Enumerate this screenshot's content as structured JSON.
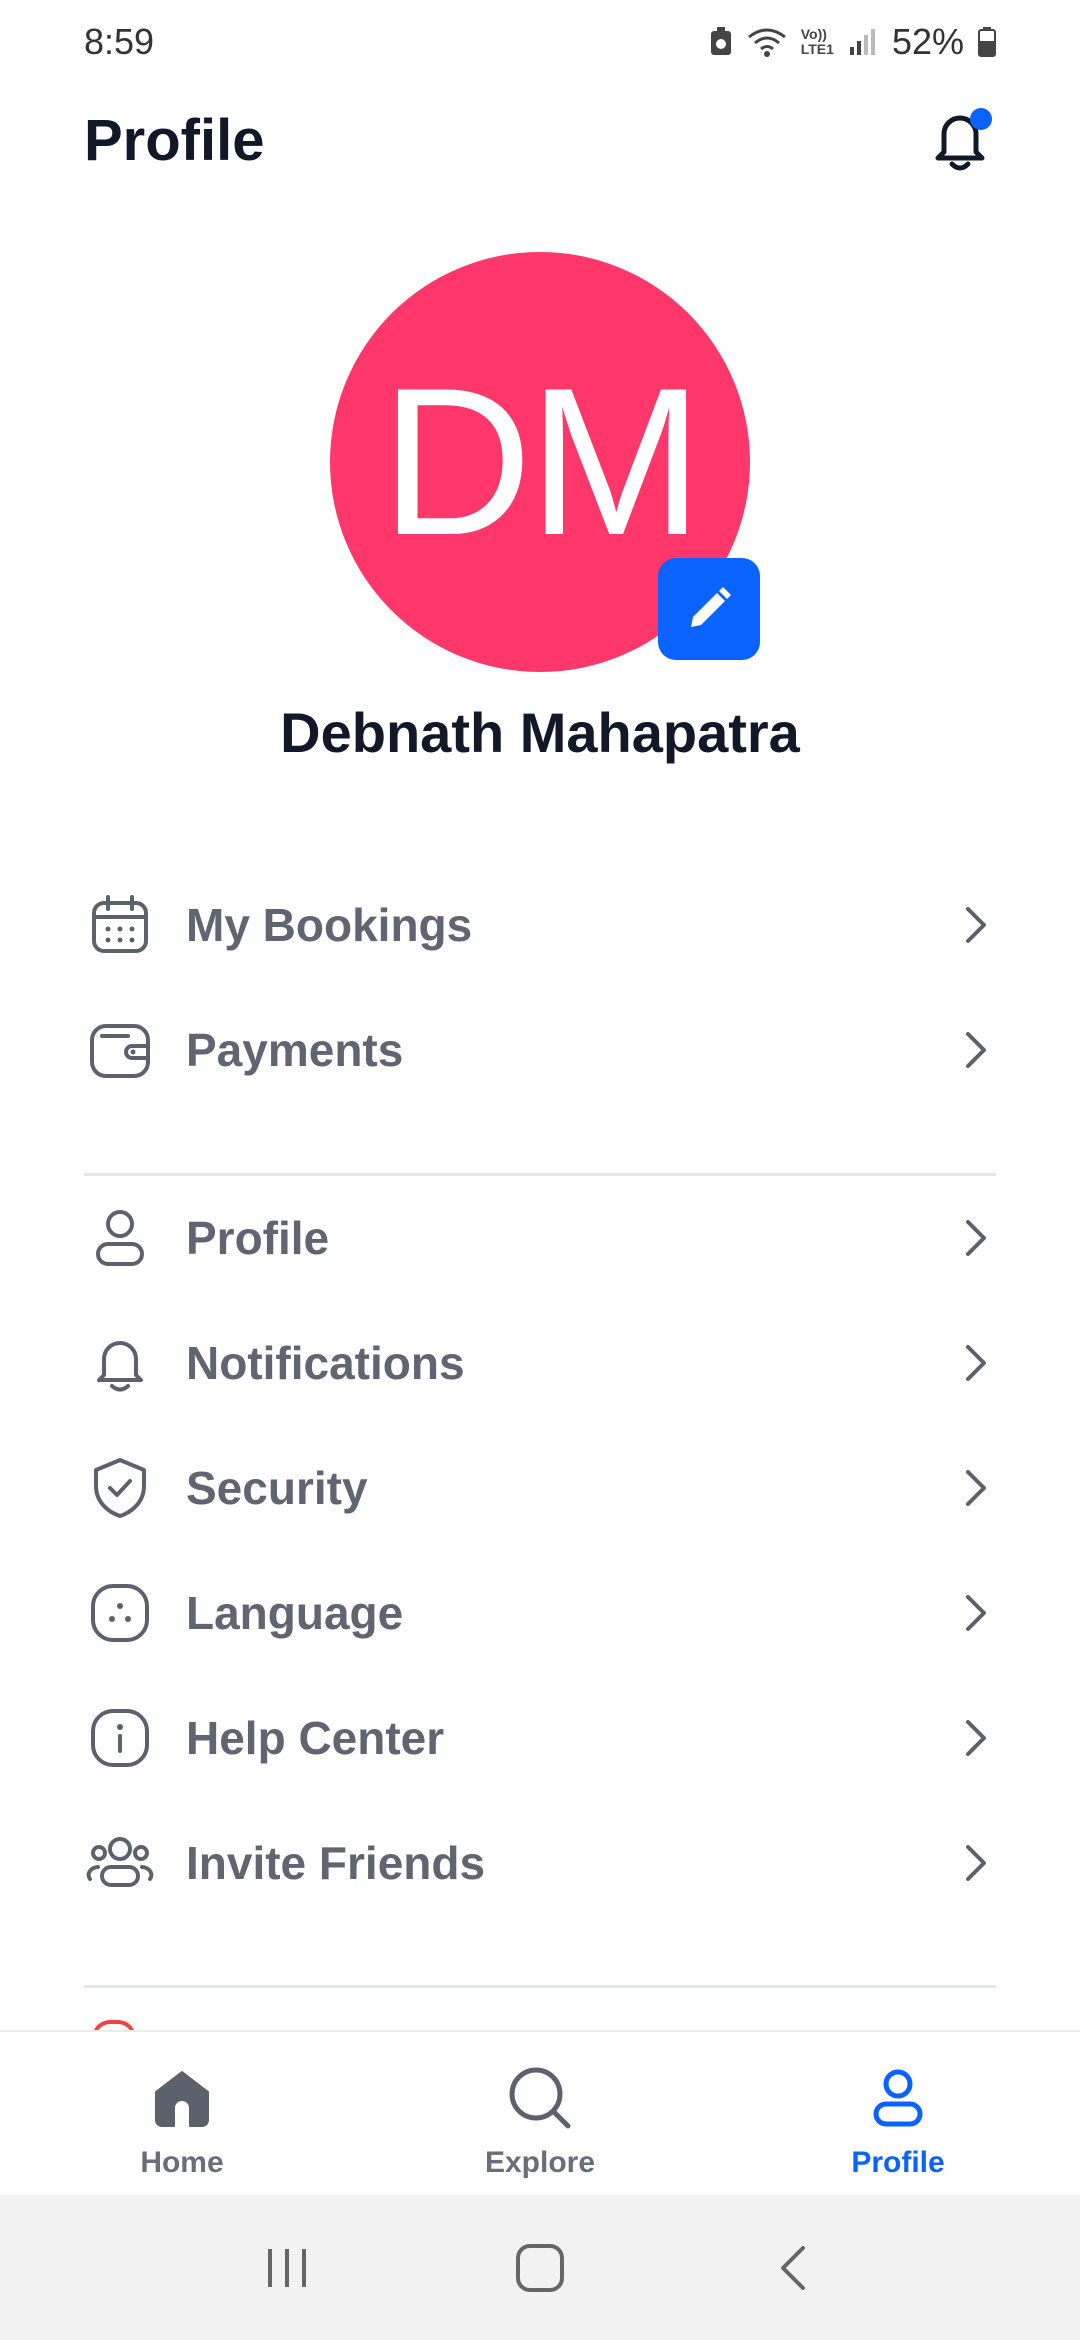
{
  "status_bar": {
    "time": "8:59",
    "network": "LTE1",
    "volte": "Vo))",
    "battery": "52%"
  },
  "header": {
    "title": "Profile"
  },
  "profile": {
    "initials": "DM",
    "name": "Debnath Mahapatra",
    "avatar_color": "#ff376b"
  },
  "menu_group_1": [
    {
      "label": "My Bookings",
      "icon": "calendar-icon"
    },
    {
      "label": "Payments",
      "icon": "wallet-icon"
    }
  ],
  "menu_group_2": [
    {
      "label": "Profile",
      "icon": "user-icon"
    },
    {
      "label": "Notifications",
      "icon": "bell-icon"
    },
    {
      "label": "Security",
      "icon": "shield-check-icon"
    },
    {
      "label": "Language",
      "icon": "language-icon"
    },
    {
      "label": "Help Center",
      "icon": "info-icon"
    },
    {
      "label": "Invite Friends",
      "icon": "users-icon"
    }
  ],
  "bottom_nav": [
    {
      "label": "Home",
      "icon": "home-icon",
      "active": false
    },
    {
      "label": "Explore",
      "icon": "search-icon",
      "active": false
    },
    {
      "label": "Profile",
      "icon": "user-icon",
      "active": true
    }
  ],
  "colors": {
    "accent": "#0a62ff",
    "text": "#111827",
    "muted": "#616571"
  }
}
